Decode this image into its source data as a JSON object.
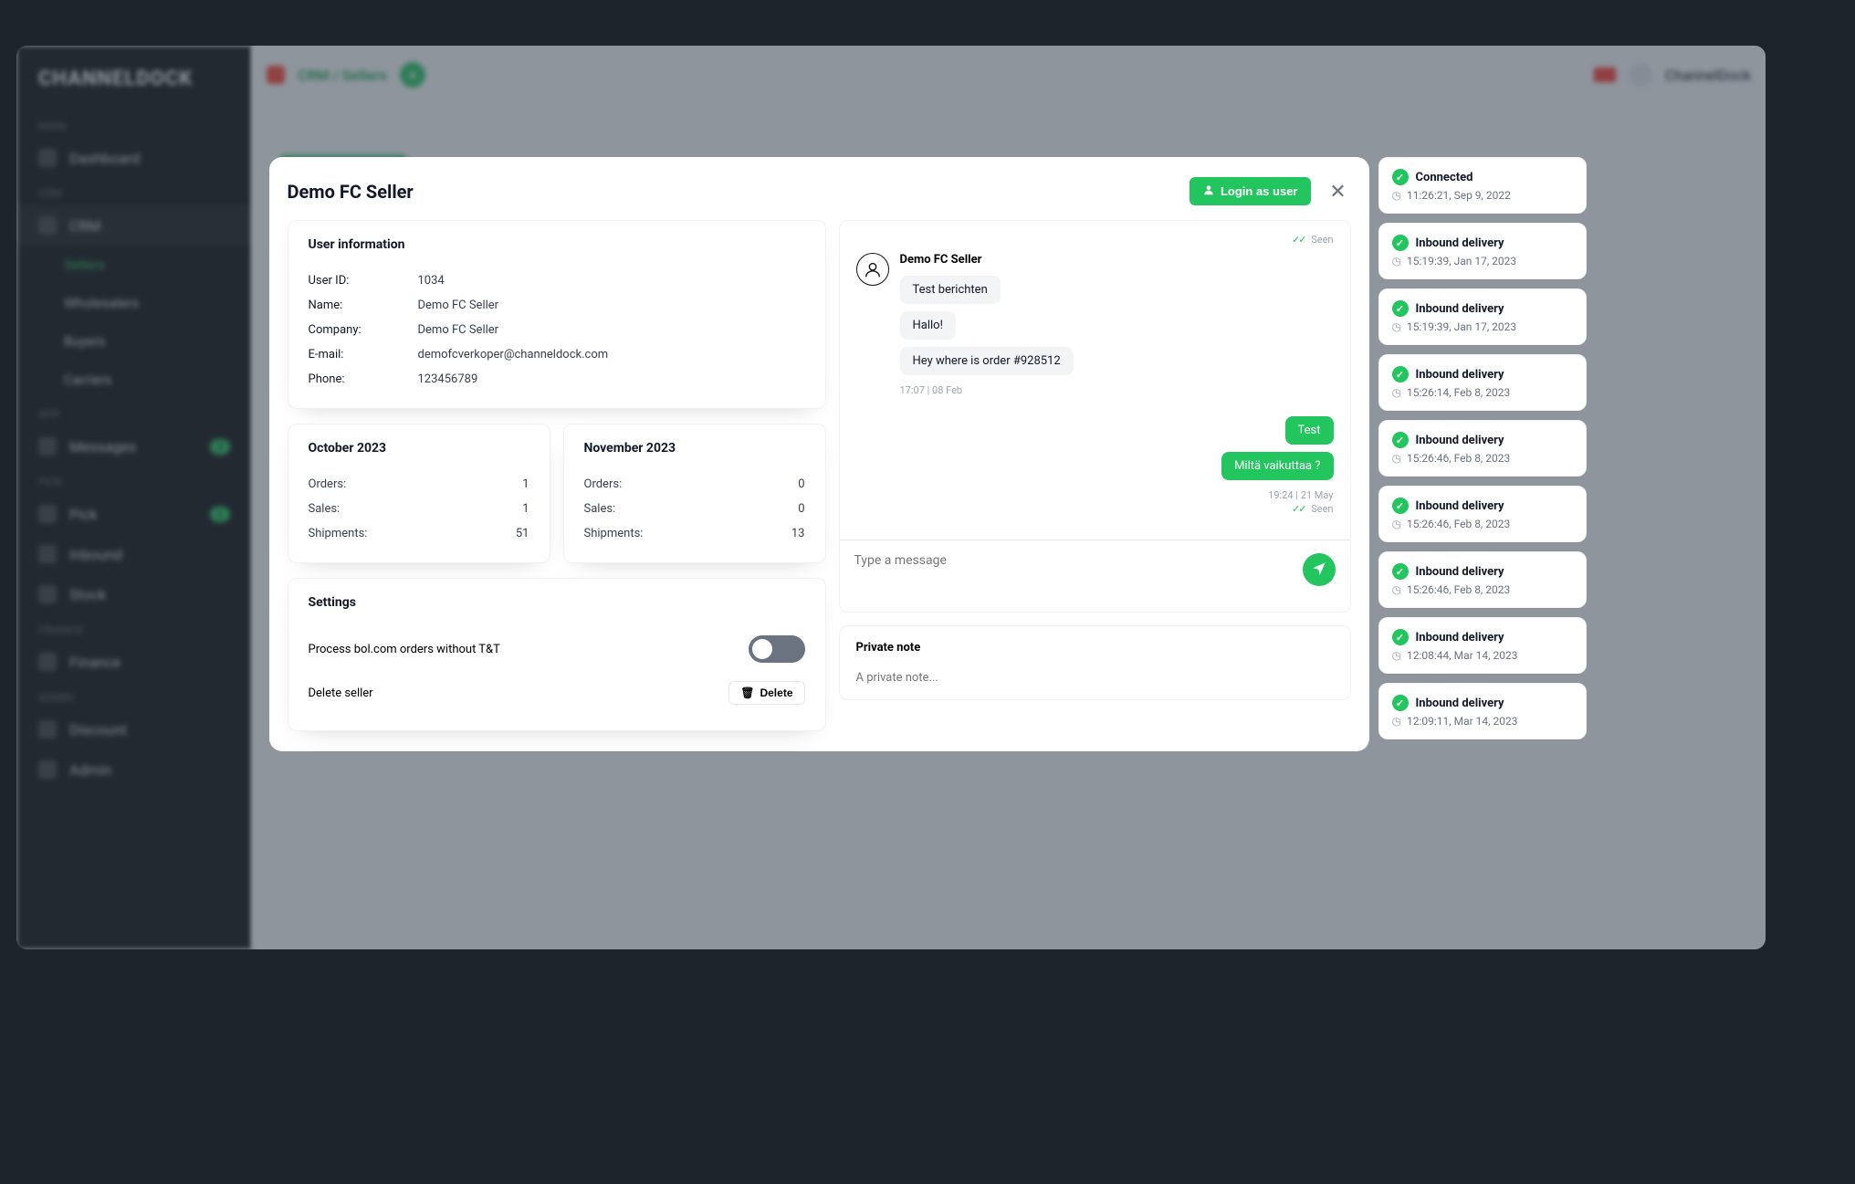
{
  "sidebar": {
    "brand": "CHANNELDOCK",
    "sections": [
      {
        "label": "Main",
        "items": [
          {
            "icon": "grid",
            "label": "Dashboard"
          }
        ]
      },
      {
        "label": "CRM",
        "items": [
          {
            "icon": "users",
            "label": "CRM",
            "expanded": true,
            "children": [
              {
                "label": "Sellers",
                "active": true
              },
              {
                "label": "Wholesalers"
              },
              {
                "label": "Buyers"
              },
              {
                "label": "Carriers"
              }
            ]
          }
        ]
      },
      {
        "label": "App",
        "items": [
          {
            "icon": "msg",
            "label": "Messages",
            "badge": "3"
          }
        ]
      },
      {
        "label": "Pick",
        "items": [
          {
            "icon": "box",
            "label": "Pick",
            "badge": "2"
          },
          {
            "icon": "truck",
            "label": "Inbound"
          },
          {
            "icon": "note",
            "label": "Stock"
          }
        ]
      },
      {
        "label": "Finance",
        "items": [
          {
            "icon": "fin",
            "label": "Finance"
          }
        ]
      },
      {
        "label": "Admin",
        "items": [
          {
            "icon": "disc",
            "label": "Discount"
          },
          {
            "icon": "gear",
            "label": "Admin"
          }
        ]
      }
    ]
  },
  "topbar": {
    "crumb": "CRM / Sellers",
    "user": "ChannelDock"
  },
  "modal": {
    "title": "Demo FC Seller",
    "login_label": "Login as user",
    "user_info": {
      "heading": "User information",
      "rows": [
        {
          "k": "User ID:",
          "v": "1034"
        },
        {
          "k": "Name:",
          "v": "Demo FC Seller"
        },
        {
          "k": "Company:",
          "v": "Demo FC Seller"
        },
        {
          "k": "E-mail:",
          "v": "demofcverkoper@channeldock.com"
        },
        {
          "k": "Phone:",
          "v": "123456789"
        }
      ]
    },
    "months": [
      {
        "title": "October 2023",
        "stats": [
          {
            "k": "Orders:",
            "v": "1"
          },
          {
            "k": "Sales:",
            "v": "1"
          },
          {
            "k": "Shipments:",
            "v": "51"
          }
        ]
      },
      {
        "title": "November 2023",
        "stats": [
          {
            "k": "Orders:",
            "v": "0"
          },
          {
            "k": "Sales:",
            "v": "0"
          },
          {
            "k": "Shipments:",
            "v": "13"
          }
        ]
      }
    ],
    "settings": {
      "heading": "Settings",
      "rows": [
        {
          "label": "Process bol.com orders without T&T",
          "type": "toggle"
        },
        {
          "label": "Delete seller",
          "type": "delete",
          "button": "Delete"
        }
      ]
    },
    "chat": {
      "seen_label": "Seen",
      "from_name": "Demo FC Seller",
      "incoming": [
        "Test berichten",
        "Hallo!",
        "Hey where is order #928512"
      ],
      "incoming_time": "17:07 | 08 Feb",
      "outgoing": [
        "Test",
        "Miltä vaikuttaa ?"
      ],
      "outgoing_time": "19:24 | 21 May",
      "input_placeholder": "Type a message"
    },
    "note": {
      "heading": "Private note",
      "placeholder": "A private note..."
    }
  },
  "activity": [
    {
      "title": "Connected",
      "time": "11:26:21, Sep 9, 2022"
    },
    {
      "title": "Inbound delivery",
      "time": "15:19:39, Jan 17, 2023"
    },
    {
      "title": "Inbound delivery",
      "time": "15:19:39, Jan 17, 2023"
    },
    {
      "title": "Inbound delivery",
      "time": "15:26:14, Feb 8, 2023"
    },
    {
      "title": "Inbound delivery",
      "time": "15:26:46, Feb 8, 2023"
    },
    {
      "title": "Inbound delivery",
      "time": "15:26:46, Feb 8, 2023"
    },
    {
      "title": "Inbound delivery",
      "time": "15:26:46, Feb 8, 2023"
    },
    {
      "title": "Inbound delivery",
      "time": "12:08:44, Mar 14, 2023"
    },
    {
      "title": "Inbound delivery",
      "time": "12:09:11, Mar 14, 2023"
    }
  ]
}
